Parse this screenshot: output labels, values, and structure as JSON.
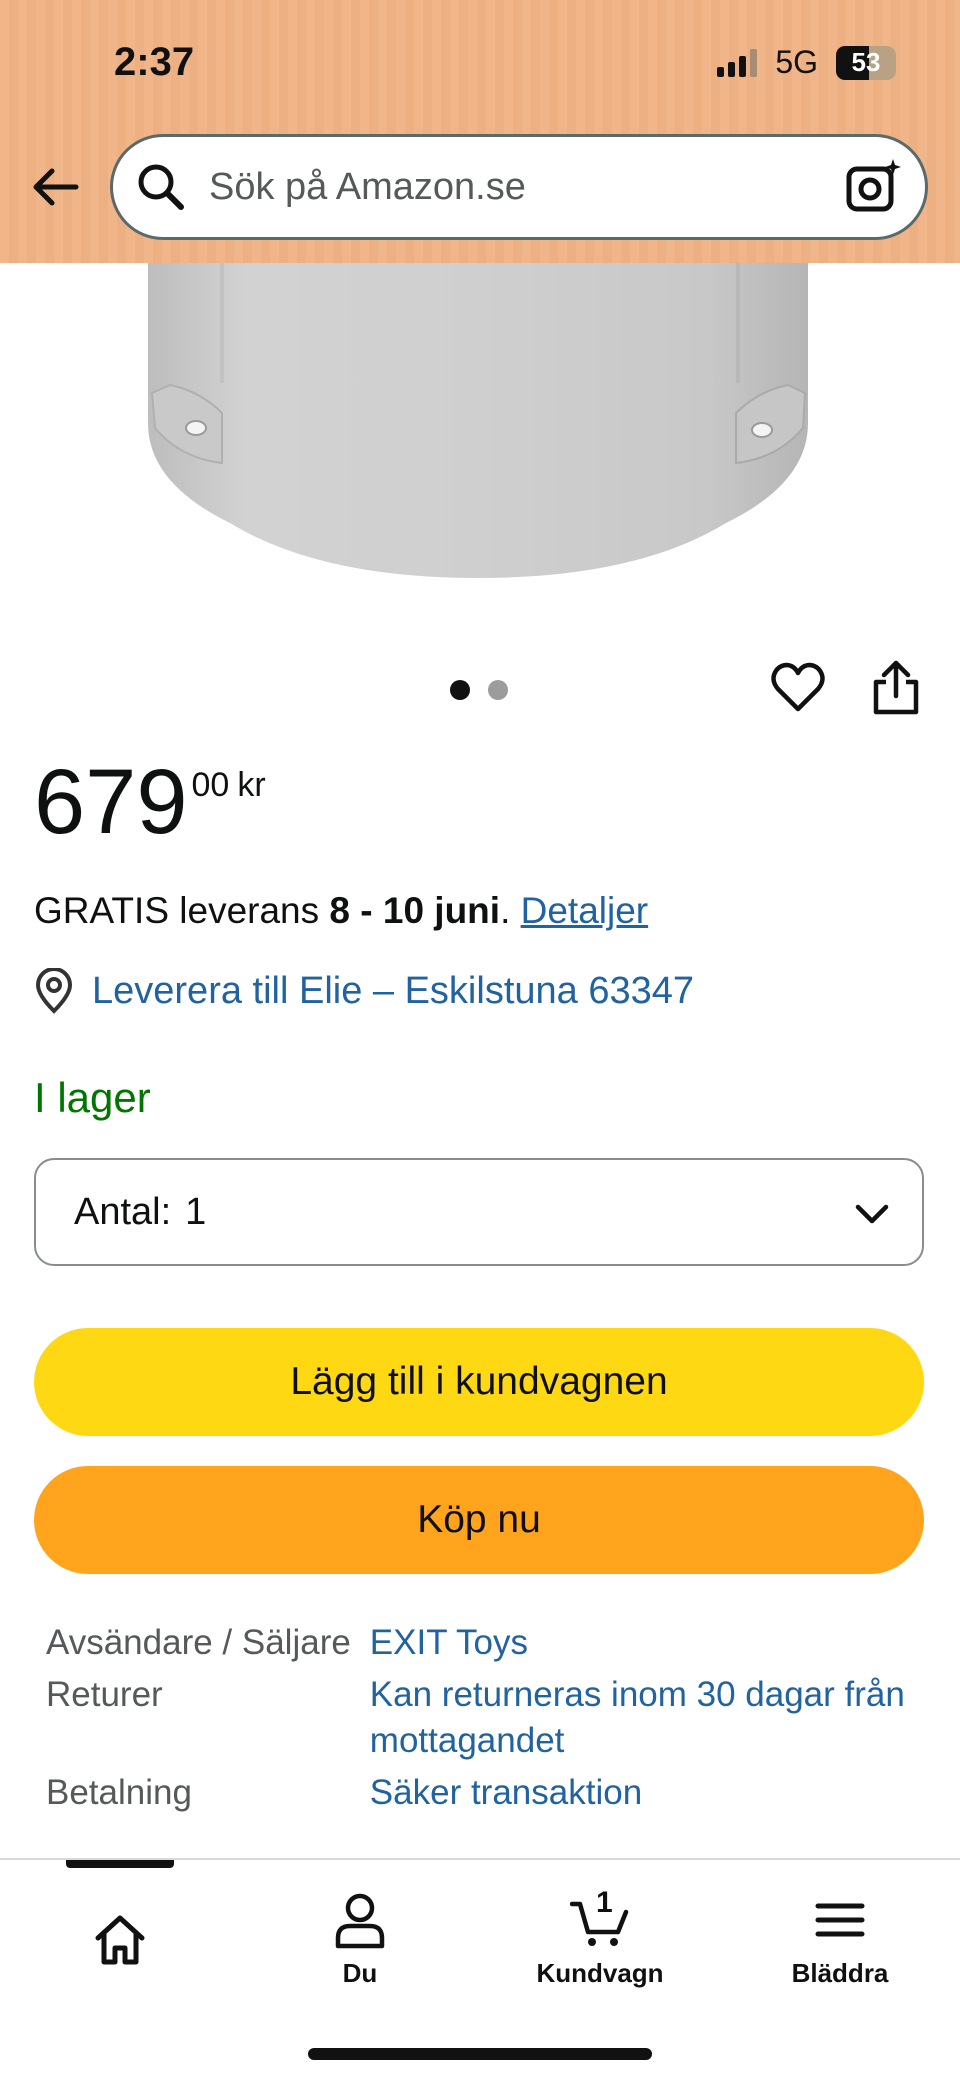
{
  "status_bar": {
    "time": "2:37",
    "network": "5G",
    "battery": "53"
  },
  "search": {
    "placeholder": "Sök på Amazon.se"
  },
  "product": {
    "price_whole": "679",
    "price_fraction": "00",
    "currency": "kr",
    "delivery_prefix": "GRATIS leverans",
    "delivery_dates": "8 - 10 juni",
    "delivery_details_link": "Detaljer",
    "deliver_to": "Leverera till Elie – Eskilstuna 63347",
    "stock_status": "I lager",
    "carousel_pages": 2,
    "carousel_active": 1
  },
  "quantity": {
    "label": "Antal:",
    "value": "1"
  },
  "buttons": {
    "add_to_cart": "Lägg till i kundvagnen",
    "buy_now": "Köp nu"
  },
  "info_rows": [
    {
      "key": "Avsändare / Säljare",
      "value": "EXIT Toys"
    },
    {
      "key": "Returer",
      "value": "Kan returneras inom 30 dagar från mottagandet"
    },
    {
      "key": "Betalning",
      "value": "Säker transaktion"
    }
  ],
  "bottom_nav": {
    "items": [
      {
        "label": "",
        "icon": "home-icon"
      },
      {
        "label": "Du",
        "icon": "user-icon"
      },
      {
        "label": "Kundvagn",
        "icon": "cart-icon",
        "badge": "1"
      },
      {
        "label": "Bläddra",
        "icon": "menu-icon"
      }
    ]
  },
  "colors": {
    "header_bg": "#f0b588",
    "link": "#2162a1",
    "in_stock": "#007600",
    "cart_button": "#ffd814",
    "buy_button": "#ffa41c"
  }
}
